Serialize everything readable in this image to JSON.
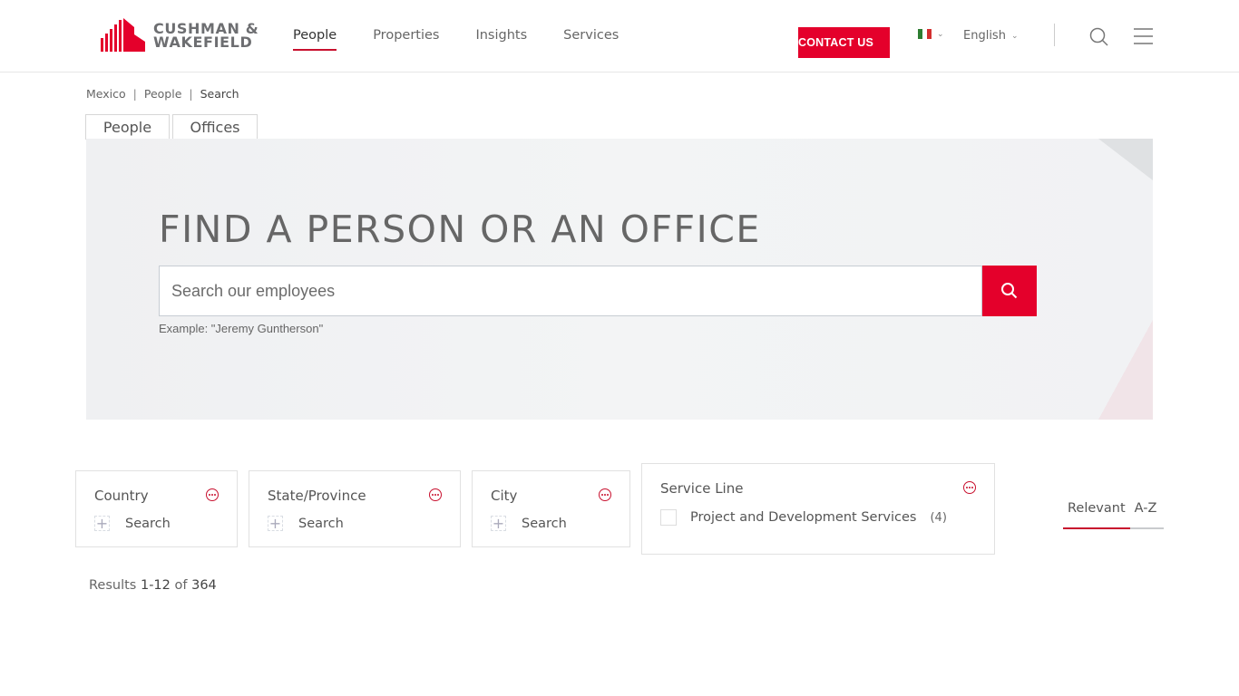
{
  "brand": {
    "name_line1": "CUSHMAN &",
    "name_line2": "WAKEFIELD",
    "accent_color": "#e4002b"
  },
  "nav": {
    "items": [
      {
        "label": "People",
        "active": true
      },
      {
        "label": "Properties",
        "active": false
      },
      {
        "label": "Insights",
        "active": false
      },
      {
        "label": "Services",
        "active": false
      }
    ],
    "contact_label": "CONTACT US",
    "country_flag": "mexico-flag",
    "language": "English",
    "icons": {
      "search": "search-icon",
      "menu": "hamburger-menu-icon"
    }
  },
  "breadcrumb": {
    "items": [
      "Mexico",
      "People",
      "Search"
    ],
    "separator": "|"
  },
  "tabs": [
    {
      "label": "People",
      "active": true
    },
    {
      "label": "Offices",
      "active": false
    }
  ],
  "hero": {
    "title": "FIND A PERSON OR AN OFFICE",
    "search_placeholder": "Search our employees",
    "search_value": "",
    "example": "Example: \"Jeremy Gunthersоn\""
  },
  "filters": {
    "country": {
      "title": "Country",
      "add_label": "Search"
    },
    "state": {
      "title": "State/Province",
      "add_label": "Search"
    },
    "city": {
      "title": "City",
      "add_label": "Search"
    },
    "service_line": {
      "title": "Service Line",
      "options": [
        {
          "label": "Project and Development Services",
          "count": "(4)",
          "checked": false
        }
      ]
    }
  },
  "sort": {
    "options": [
      "Relevant",
      "A-Z"
    ],
    "selected": "Relevant"
  },
  "results": {
    "prefix": "Results",
    "range": "1-12",
    "of_label": "of",
    "total": "364"
  }
}
